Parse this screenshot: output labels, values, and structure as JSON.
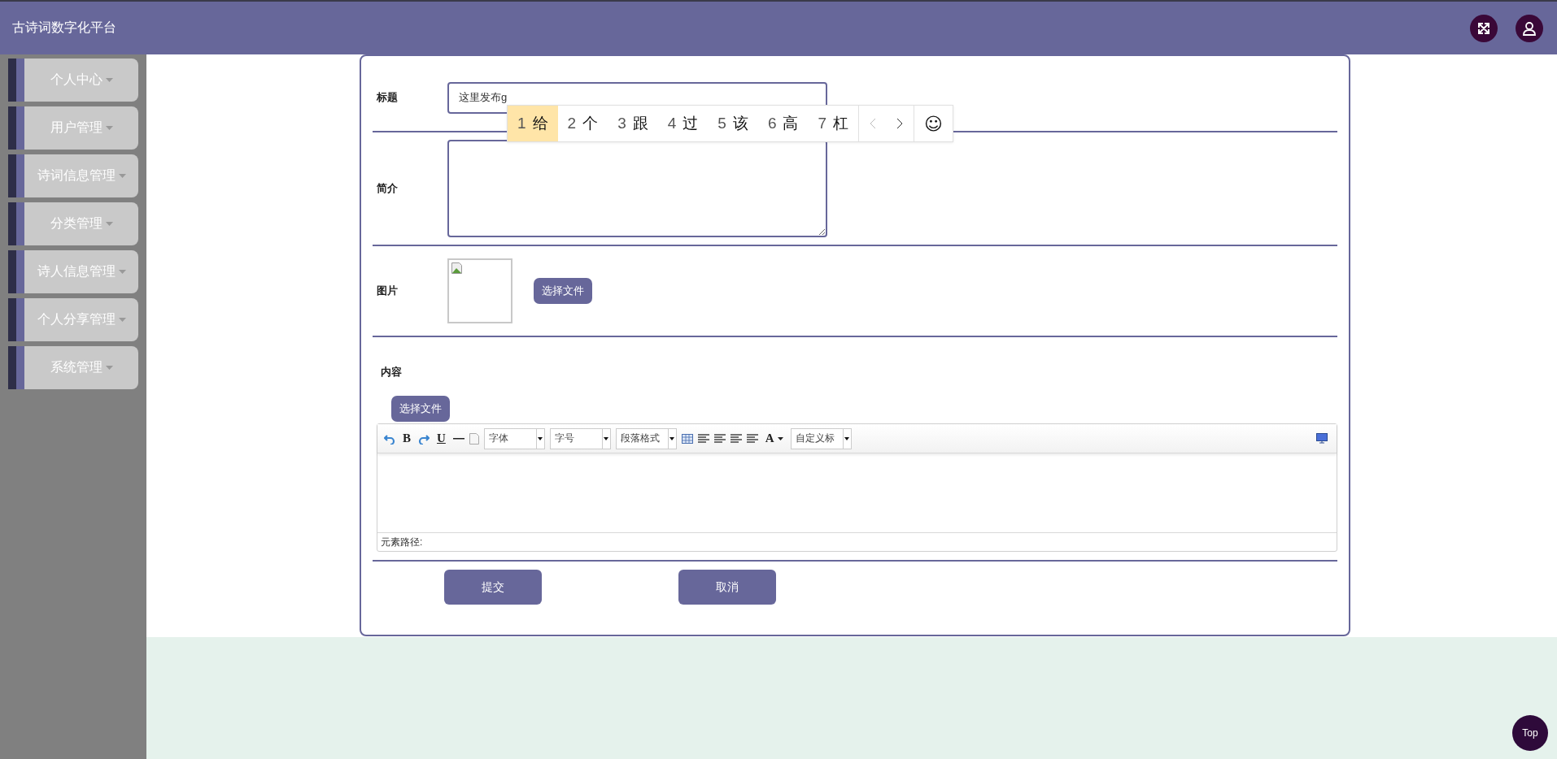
{
  "header": {
    "title": "古诗词数字化平台"
  },
  "sidebar": {
    "items": [
      {
        "label": "个人中心"
      },
      {
        "label": "用户管理"
      },
      {
        "label": "诗词信息管理"
      },
      {
        "label": "分类管理"
      },
      {
        "label": "诗人信息管理"
      },
      {
        "label": "个人分享管理"
      },
      {
        "label": "系统管理"
      }
    ]
  },
  "form": {
    "fields": [
      {
        "kind": "text",
        "label": "标题",
        "value": "这里发布g"
      },
      {
        "kind": "textarea",
        "label": "简介"
      },
      {
        "kind": "image",
        "label": "图片",
        "button": "选择文件"
      },
      {
        "kind": "editor",
        "label": "内容",
        "button": "选择文件",
        "path_label": "元素路径:",
        "toolbar": [
          {
            "kind": "undo"
          },
          {
            "kind": "bold",
            "text": "B"
          },
          {
            "kind": "redo"
          },
          {
            "kind": "underline",
            "text": "U"
          },
          {
            "kind": "hr"
          },
          {
            "kind": "page"
          },
          {
            "kind": "select",
            "text": "字体"
          },
          {
            "kind": "select",
            "text": "字号"
          },
          {
            "kind": "select",
            "text": "段落格式"
          },
          {
            "kind": "table"
          },
          {
            "kind": "align"
          },
          {
            "kind": "align"
          },
          {
            "kind": "align"
          },
          {
            "kind": "align"
          },
          {
            "kind": "color",
            "text": "A"
          },
          {
            "kind": "select",
            "text": "自定义标"
          },
          {
            "kind": "preview"
          }
        ]
      }
    ],
    "buttons": [
      "提交",
      "取消"
    ]
  },
  "ime": {
    "candidates": [
      {
        "index": "1",
        "text": "给",
        "selected": true
      },
      {
        "index": "2",
        "text": "个",
        "selected": false
      },
      {
        "index": "3",
        "text": "跟",
        "selected": false
      },
      {
        "index": "4",
        "text": "过",
        "selected": false
      },
      {
        "index": "5",
        "text": "该",
        "selected": false
      },
      {
        "index": "6",
        "text": "高",
        "selected": false
      },
      {
        "index": "7",
        "text": "杠",
        "selected": false
      }
    ],
    "emoji": "☺"
  },
  "top_button": "Top"
}
